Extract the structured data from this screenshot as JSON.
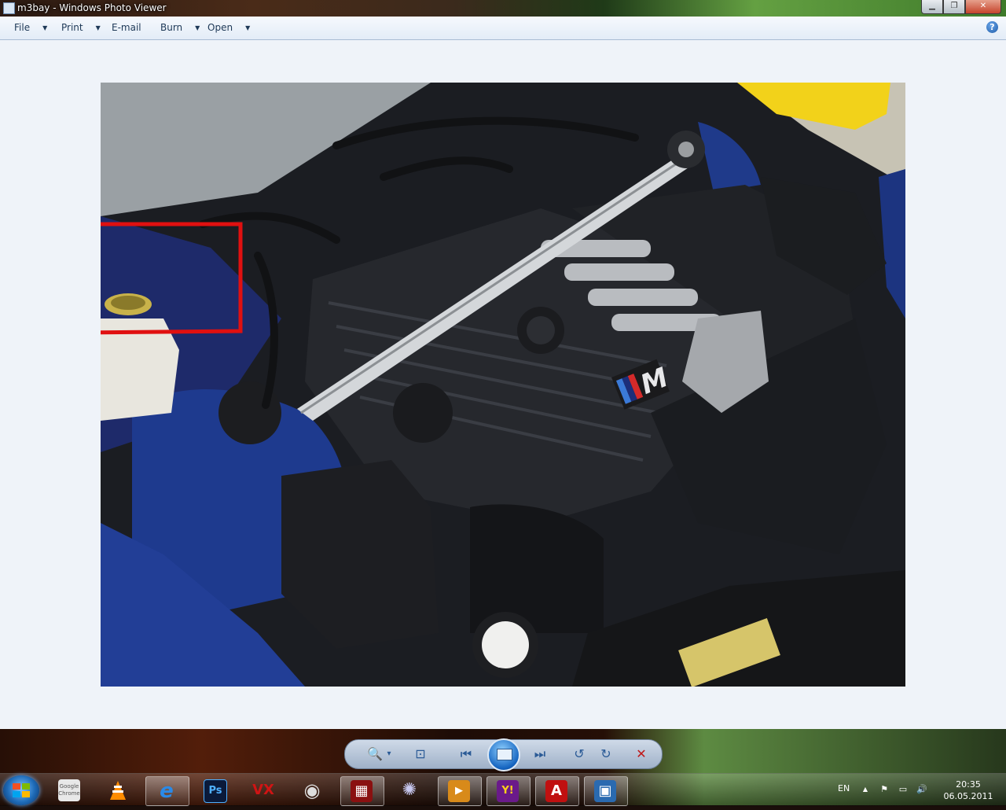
{
  "window": {
    "title": "m3bay - Windows Photo Viewer",
    "controls": {
      "minimize": "▁",
      "restore": "❐",
      "close": "✕"
    }
  },
  "menubar": {
    "items": [
      {
        "label": "File",
        "has_dropdown": true
      },
      {
        "label": "Print",
        "has_dropdown": true
      },
      {
        "label": "E-mail",
        "has_dropdown": false
      },
      {
        "label": "Burn",
        "has_dropdown": true
      },
      {
        "label": "Open",
        "has_dropdown": true
      }
    ],
    "help_icon": "?"
  },
  "photo": {
    "subject": "BMW M3 engine bay",
    "annotation_color": "#e01010",
    "badge_text": "M"
  },
  "viewer_controls": {
    "icons": [
      "zoom-icon",
      "actual-size-icon",
      "previous-icon",
      "slideshow-icon",
      "next-icon",
      "rotate-counterclockwise-icon",
      "rotate-clockwise-icon",
      "delete-icon"
    ],
    "glyphs": {
      "zoom": "🔍",
      "actual_size": "⊡",
      "previous": "⏮",
      "next": "⏭",
      "rotate_ccw": "↺",
      "rotate_cw": "↻",
      "delete": "✕",
      "zoom_arrow": "▾"
    }
  },
  "taskbar": {
    "apps": [
      {
        "name": "chrome",
        "label": "Google Chrome",
        "color": "#e8e8e8"
      },
      {
        "name": "vlc",
        "label": "",
        "color": "#ff8c00"
      },
      {
        "name": "internet-explorer",
        "label": "e",
        "color": "#1e7ad6"
      },
      {
        "name": "photoshop",
        "label": "Ps",
        "color": "#0a1a3a"
      },
      {
        "name": "vx",
        "label": "VX",
        "color": "#b01010"
      },
      {
        "name": "disc-app",
        "label": "◉",
        "color": "#333333"
      },
      {
        "name": "film-app",
        "label": "▦",
        "color": "#8a1010"
      },
      {
        "name": "network-app",
        "label": "✺",
        "color": "#3a3a6a"
      },
      {
        "name": "media-app",
        "label": "▶",
        "color": "#d88a1a"
      },
      {
        "name": "yahoo-messenger",
        "label": "Y!",
        "color": "#6a1a8a"
      },
      {
        "name": "acrobat",
        "label": "A",
        "color": "#c01010"
      },
      {
        "name": "photo-viewer",
        "label": "▣",
        "color": "#2a6ab0"
      }
    ],
    "tray": {
      "language": "EN",
      "show_hidden_icon": "▲",
      "flag_icon": "⚑",
      "network_icon": "▭",
      "volume_icon": "🔊",
      "time": "20:35",
      "date": "06.05.2011"
    }
  }
}
